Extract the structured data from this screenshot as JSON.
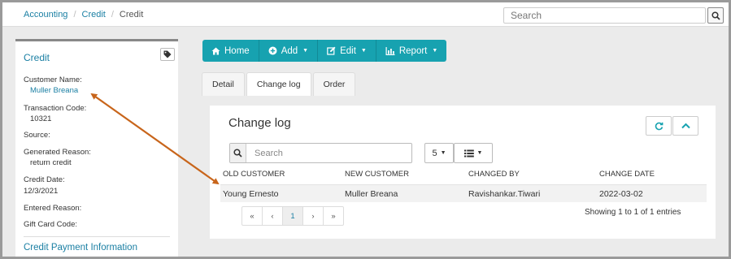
{
  "breadcrumb": {
    "items": [
      "Accounting",
      "Credit"
    ],
    "current": "Credit"
  },
  "top_search": {
    "placeholder": "Search",
    "icon": "search-icon"
  },
  "sidebar": {
    "title": "Credit",
    "tag_icon": "tag-icon",
    "fields": [
      {
        "label": "Customer Name:",
        "value": "Muller Breana"
      },
      {
        "label": "Transaction Code:",
        "value": "10321"
      },
      {
        "label": "Source:",
        "value": ""
      },
      {
        "label": "Generated Reason:",
        "value": "return credit"
      },
      {
        "label": "Credit Date:",
        "value": "12/3/2021"
      },
      {
        "label": "Entered Reason:",
        "value": ""
      },
      {
        "label": "Gift Card Code:",
        "value": ""
      }
    ],
    "section_title": "Credit Payment Information"
  },
  "toolbar": {
    "buttons": [
      {
        "label": "Home",
        "icon": "home-icon"
      },
      {
        "label": "Add",
        "icon": "plus-circle-icon"
      },
      {
        "label": "Edit",
        "icon": "edit-icon"
      },
      {
        "label": "Report",
        "icon": "bar-chart-icon"
      }
    ]
  },
  "tabs": [
    "Detail",
    "Change log",
    "Order"
  ],
  "active_tab": "Change log",
  "changelog": {
    "title": "Change log",
    "search_placeholder": "Search",
    "page_size": "5",
    "columns": [
      "Old Customer",
      "New Customer",
      "Changed By",
      "Change Date"
    ],
    "rows": [
      [
        "Young Ernesto",
        "Muller Breana",
        "Ravishankar.Tiwari",
        "2022-03-02"
      ]
    ],
    "pagination": [
      "«",
      "‹",
      "1",
      "›",
      "»"
    ],
    "current_page": "1",
    "entries_text": "Showing 1 to 1 of 1 entries"
  },
  "colors": {
    "accent": "#17a2b0",
    "link": "#1a7fa3",
    "annotation": "#c8651b"
  }
}
